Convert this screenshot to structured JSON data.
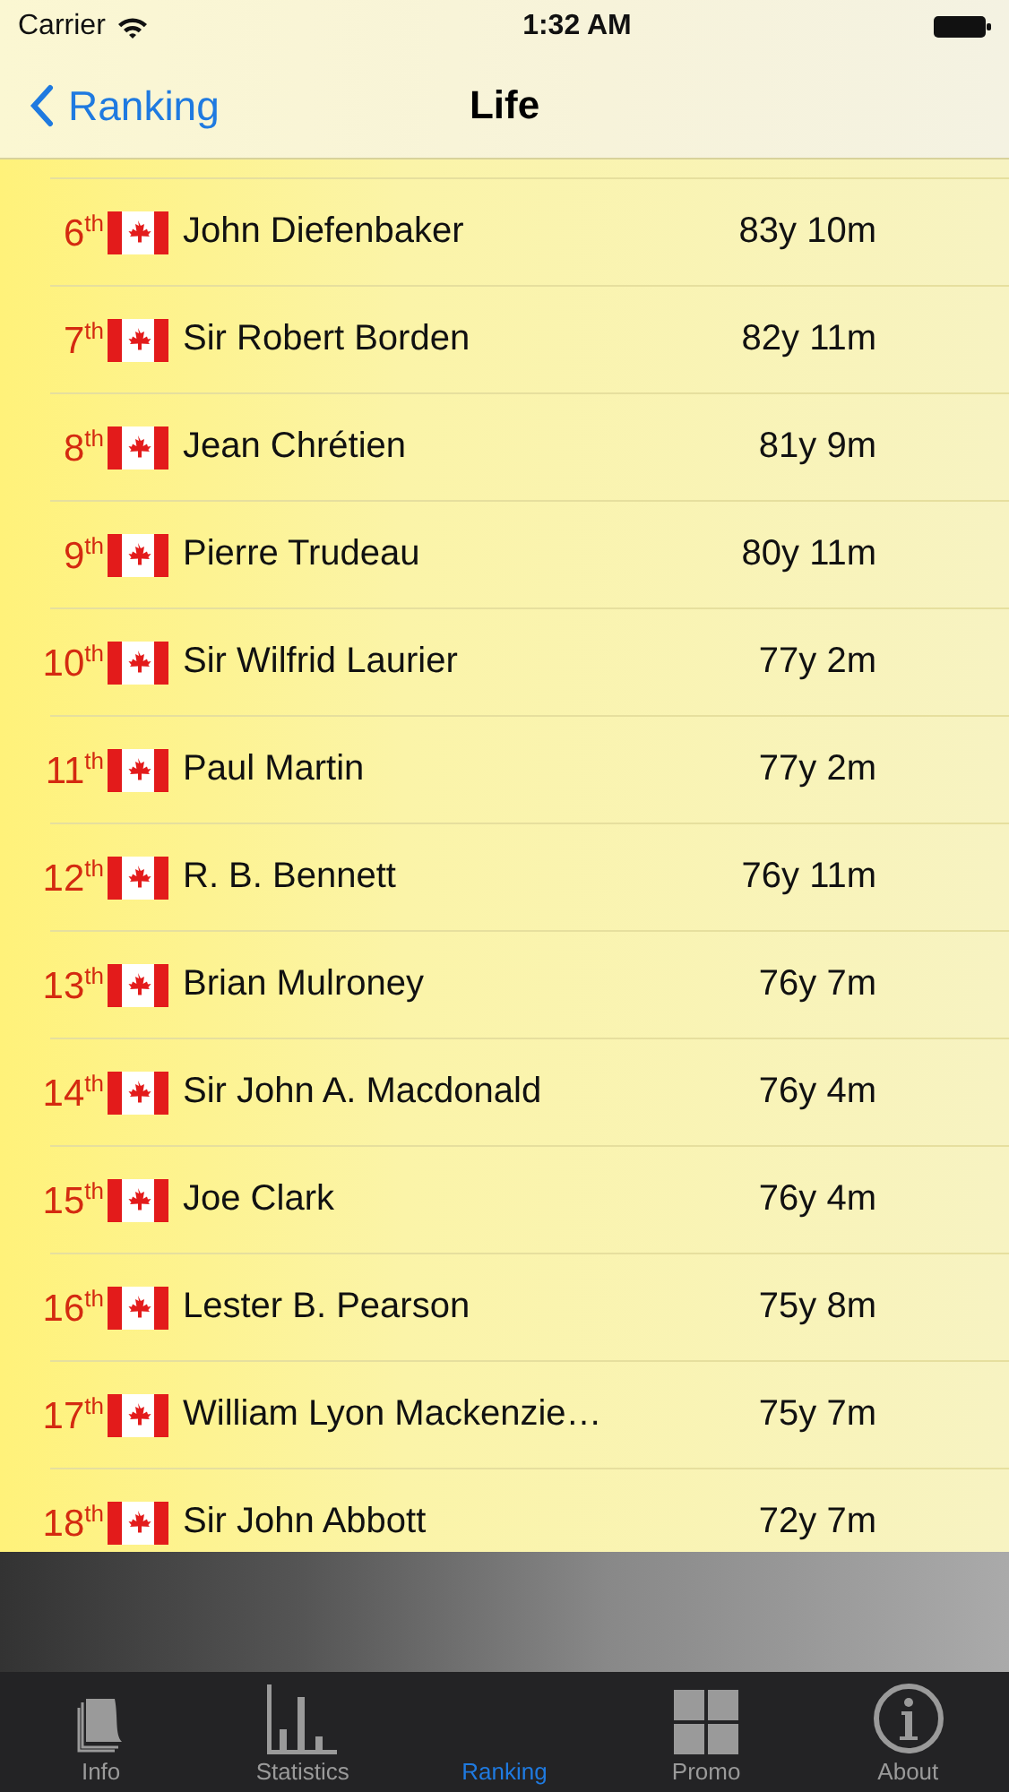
{
  "status_bar": {
    "carrier": "Carrier",
    "time": "1:32 AM"
  },
  "nav": {
    "back": "Ranking",
    "title": "Life"
  },
  "rows": [
    {
      "rank": "6$^{th}$",
      "name": "John Diefenbaker",
      "value": "83y 10m"
    },
    {
      "rank": "7$^{th}$",
      "name": "Sir Robert Borden",
      "value": "82y 11m"
    },
    {
      "rank": "8$^{th}$",
      "name": "Jean Chrétien",
      "value": "81y 9m"
    },
    {
      "rank": "9$^{th}$",
      "name": "Pierre Trudeau",
      "value": "80y 11m"
    },
    {
      "rank": "10$^{th}$",
      "name": "Sir Wilfrid Laurier",
      "value": "77y 2m"
    },
    {
      "rank": "11$^{th}$",
      "name": "Paul Martin",
      "value": "77y 2m"
    },
    {
      "rank": "12$^{th}$",
      "name": "R. B. Bennett",
      "value": "76y 11m"
    },
    {
      "rank": "13$^{th}$",
      "name": "Brian Mulroney",
      "value": "76y 7m"
    },
    {
      "rank": "14$^{th}$",
      "name": "Sir John A. Macdonald",
      "value": "76y 4m"
    },
    {
      "rank": "15$^{th}$",
      "name": "Joe Clark",
      "value": "76y 4m"
    },
    {
      "rank": "16$^{th}$",
      "name": "Lester B. Pearson",
      "value": "75y 8m"
    },
    {
      "rank": "17$^{th}$",
      "name": "William Lyon Mackenzie…",
      "value": "75y 7m"
    },
    {
      "rank": "18$^{th}$",
      "name": "Sir John Abbott",
      "value": "72y 7m"
    }
  ],
  "tabs": [
    {
      "kind": "info",
      "label": "Info",
      "selected": false
    },
    {
      "kind": "statistics",
      "label": "Statistics",
      "selected": false
    },
    {
      "kind": "ranking",
      "label": "Ranking",
      "selected": true
    },
    {
      "kind": "promo",
      "label": "Promo",
      "selected": false
    },
    {
      "kind": "about",
      "label": "About",
      "selected": false
    }
  ]
}
